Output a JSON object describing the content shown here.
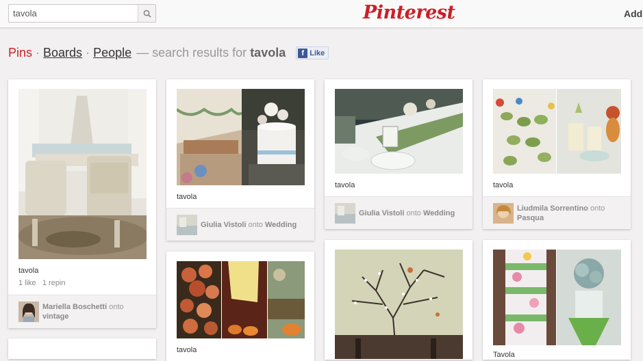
{
  "search": {
    "value": "tavola",
    "placeholder": ""
  },
  "header": {
    "logo": "Pinterest",
    "add_label": "Add"
  },
  "heading": {
    "pins": "Pins",
    "dot": "·",
    "boards": "Boards",
    "people": "People",
    "prefix": "— search results for",
    "query": "tavola",
    "fb_like": "Like",
    "fb_f": "f"
  },
  "pins": [
    {
      "desc": "tavola",
      "likes": "1 like",
      "repins": "1 repin",
      "user": "Mariella Boschetti",
      "onto": "onto",
      "board": "vintage"
    },
    {
      "desc": "tavola",
      "user": "Giulia Vistoli",
      "onto": "onto",
      "board": "Wedding"
    },
    {
      "desc": "tavola",
      "user": "Giulia Vistoli",
      "onto": "onto",
      "board": "Wedding"
    },
    {
      "desc": "tavola",
      "user": "Liudmila Sorrentino",
      "onto": "onto",
      "board": "Pasqua"
    },
    {
      "desc": "tavola"
    },
    {
      "desc": "Tavola"
    }
  ],
  "colors": {
    "brand": "#cb2027",
    "background": "#f2f0f0",
    "facebook": "#3b5998"
  }
}
